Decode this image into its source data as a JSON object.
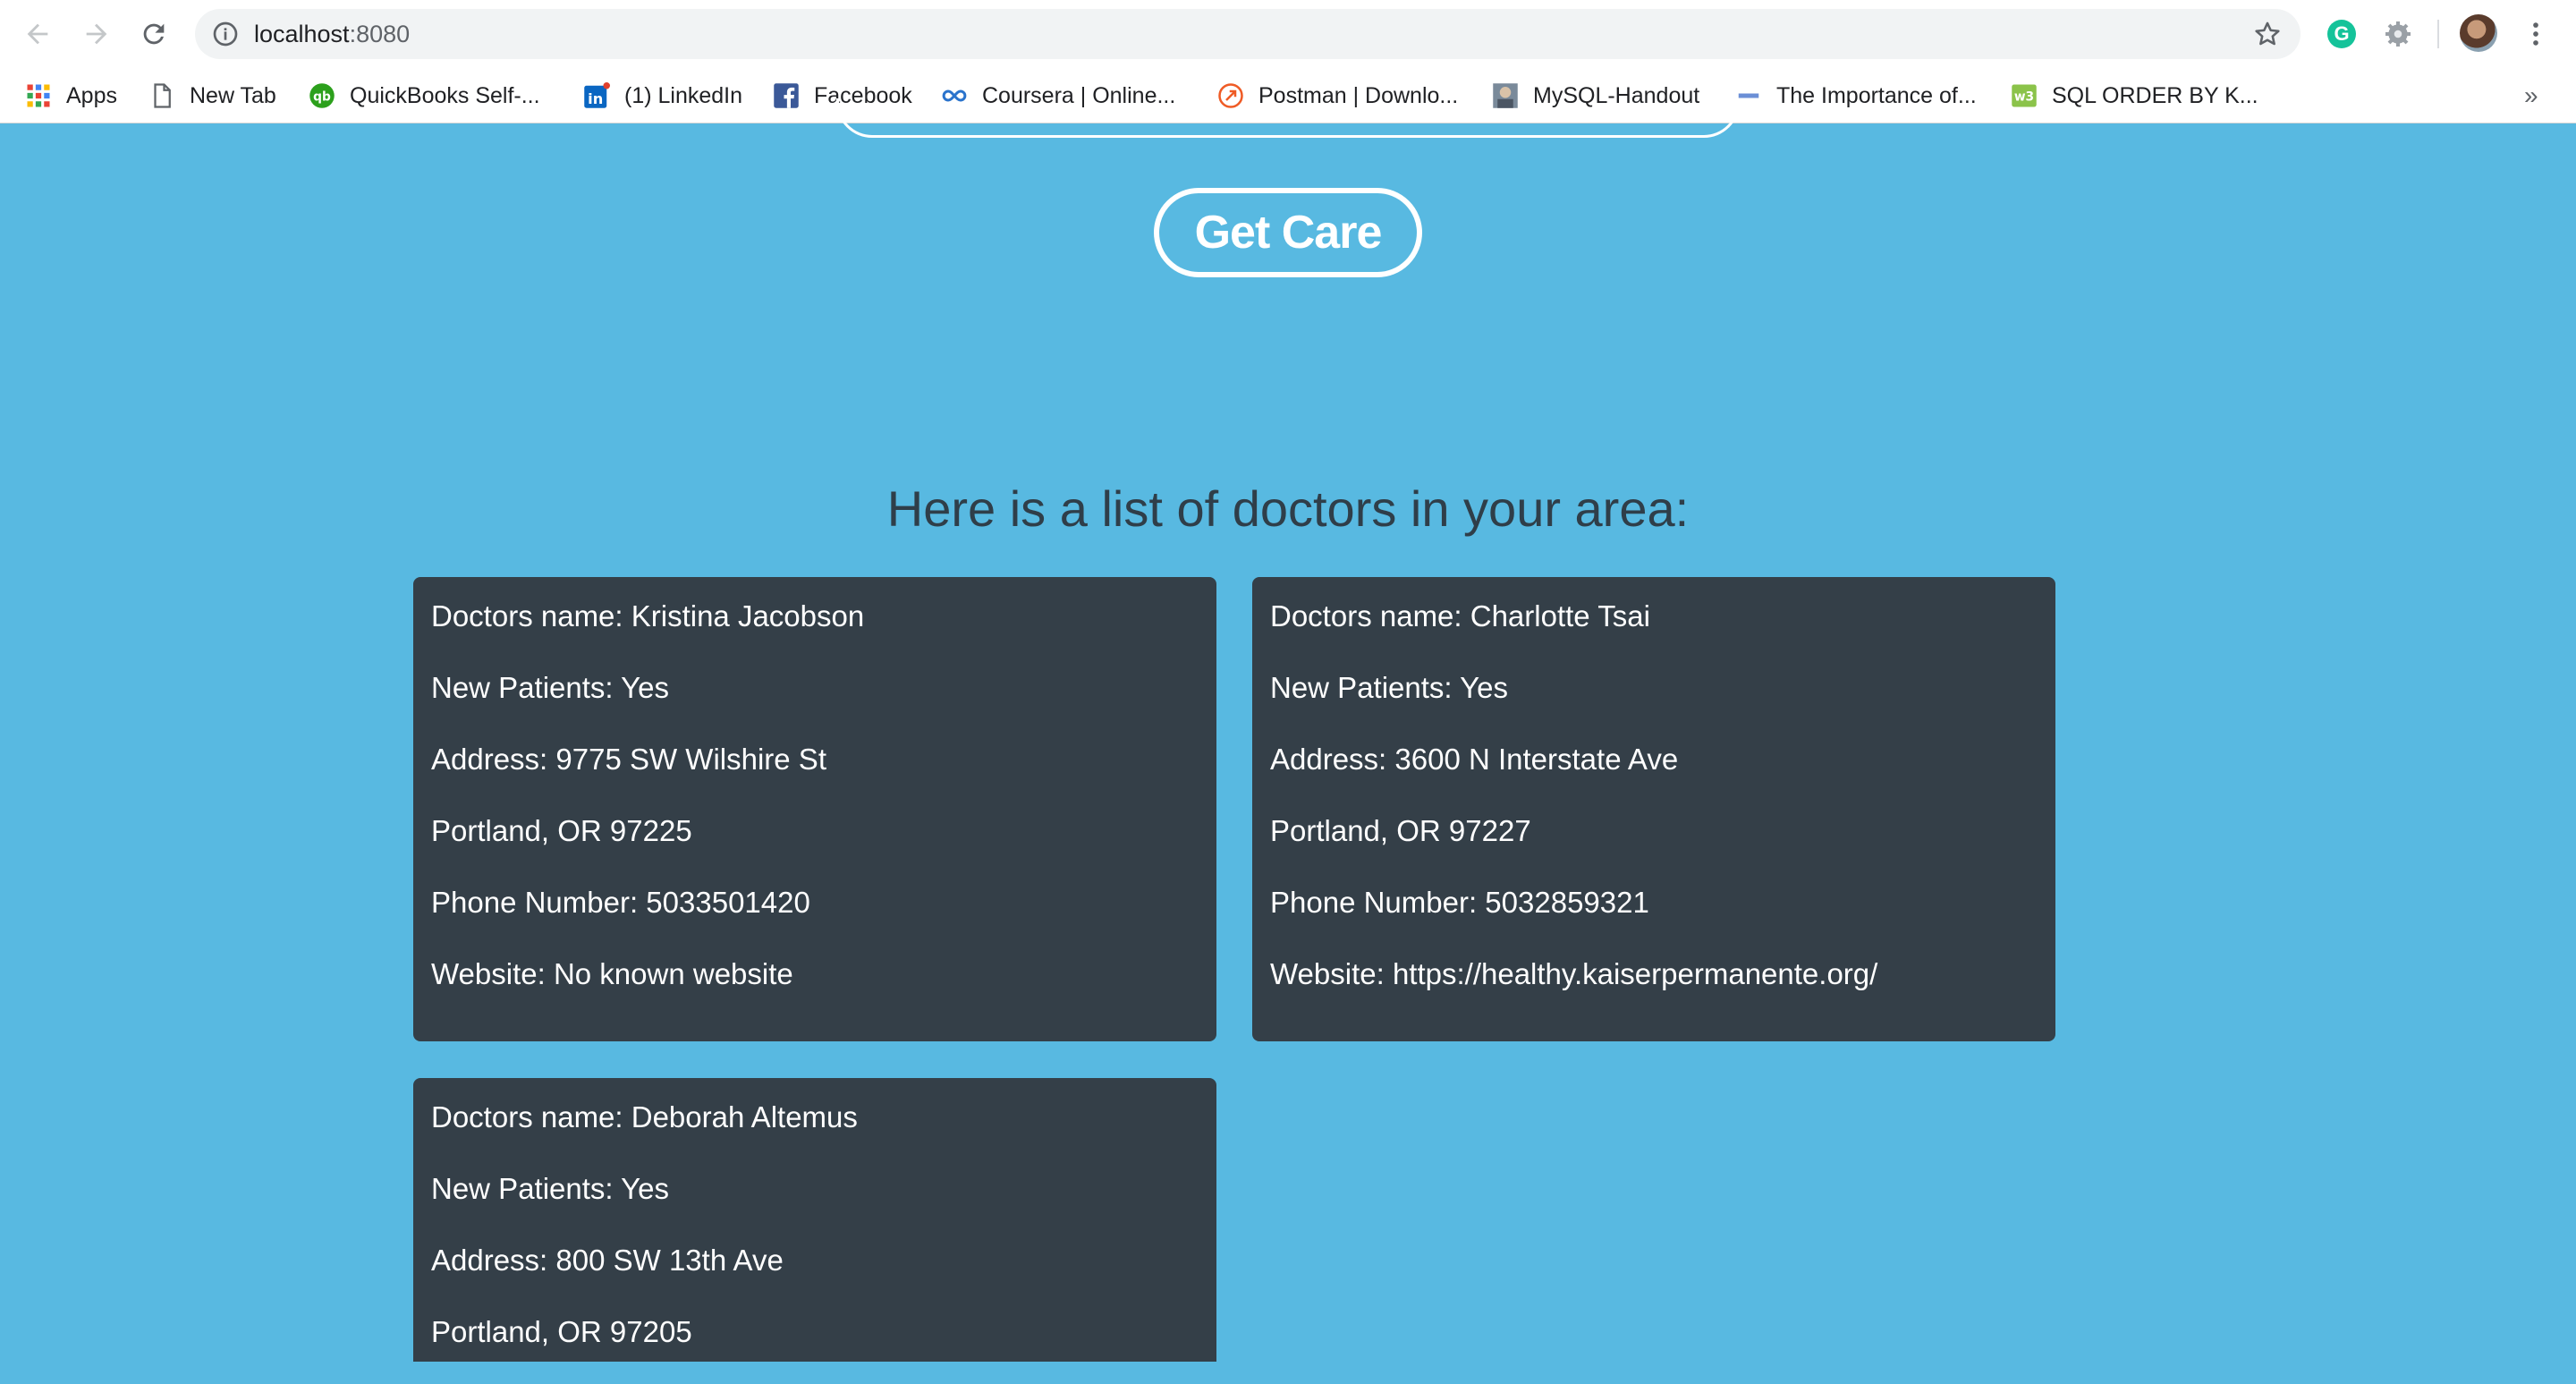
{
  "browser": {
    "url_host": "localhost",
    "url_port": ":8080",
    "bookmarks": [
      {
        "label": "Apps",
        "icon": "apps-grid-icon"
      },
      {
        "label": "New Tab",
        "icon": "page-icon"
      },
      {
        "label": "QuickBooks Self-...",
        "icon": "quickbooks-icon"
      },
      {
        "label": "(1) LinkedIn",
        "icon": "linkedin-icon"
      },
      {
        "label": "Facebook",
        "icon": "facebook-icon"
      },
      {
        "label": "Coursera | Online...",
        "icon": "coursera-icon"
      },
      {
        "label": "Postman | Downlo...",
        "icon": "postman-icon"
      },
      {
        "label": "MySQL-Handout",
        "icon": "mysql-handout-icon"
      },
      {
        "label": "The Importance of...",
        "icon": "importance-icon"
      },
      {
        "label": "SQL ORDER BY K...",
        "icon": "w3schools-icon"
      }
    ],
    "more_bookmarks": "»"
  },
  "page": {
    "get_care_label": "Get Care",
    "list_heading": "Here is a list of doctors in your area:",
    "doctors": [
      {
        "name_line": "Doctors name: Kristina Jacobson",
        "new_patients_line": "New Patients: Yes",
        "address_line": "Address: 9775 SW Wilshire St",
        "city_line": "Portland, OR 97225",
        "phone_line": "Phone Number: 5033501420",
        "website_line": "Website: No known website"
      },
      {
        "name_line": "Doctors name: Charlotte Tsai",
        "new_patients_line": "New Patients: Yes",
        "address_line": "Address: 3600 N Interstate Ave",
        "city_line": "Portland, OR 97227",
        "phone_line": "Phone Number: 5032859321",
        "website_line": "Website: https://healthy.kaiserpermanente.org/"
      },
      {
        "name_line": "Doctors name: Deborah Altemus",
        "new_patients_line": "New Patients: Yes",
        "address_line": "Address: 800 SW 13th Ave",
        "city_line": "Portland, OR 97205"
      }
    ]
  },
  "colors": {
    "page_background": "#58b9e1",
    "card_background": "#343f48",
    "heading_text": "#2f3e49",
    "button_border": "#ffffff"
  }
}
